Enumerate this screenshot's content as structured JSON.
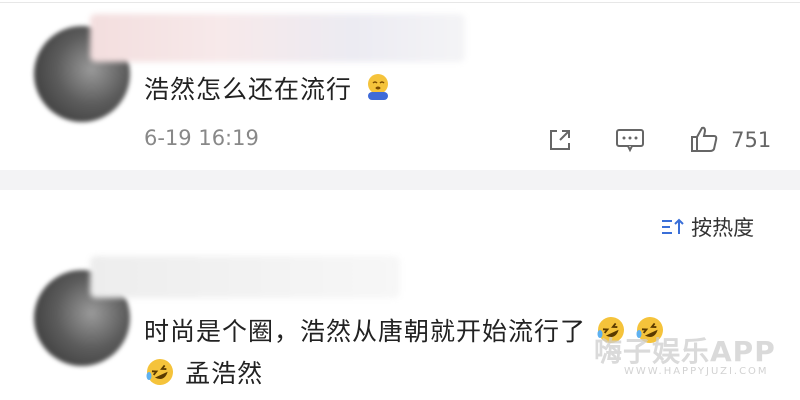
{
  "comments": [
    {
      "text": "浩然怎么还在流行",
      "emoji": "shy-emoji",
      "date": "6-19 16:19",
      "likes": "751"
    },
    {
      "text": "时尚是个圈，浩然从唐朝就开始流行了",
      "line2": "孟浩然",
      "emoji": "rofl-emoji"
    }
  ],
  "sort": {
    "label": "按热度"
  },
  "watermark": {
    "main": "嗨子娱乐APP",
    "sub": "WWW.HAPPYJUZI.COM"
  },
  "colors": {
    "meta": "#888888",
    "divider": "#f3f3f5",
    "emoji_face": "#f5c33b"
  },
  "icons": [
    "share-icon",
    "comment-icon",
    "like-icon",
    "sort-icon"
  ]
}
